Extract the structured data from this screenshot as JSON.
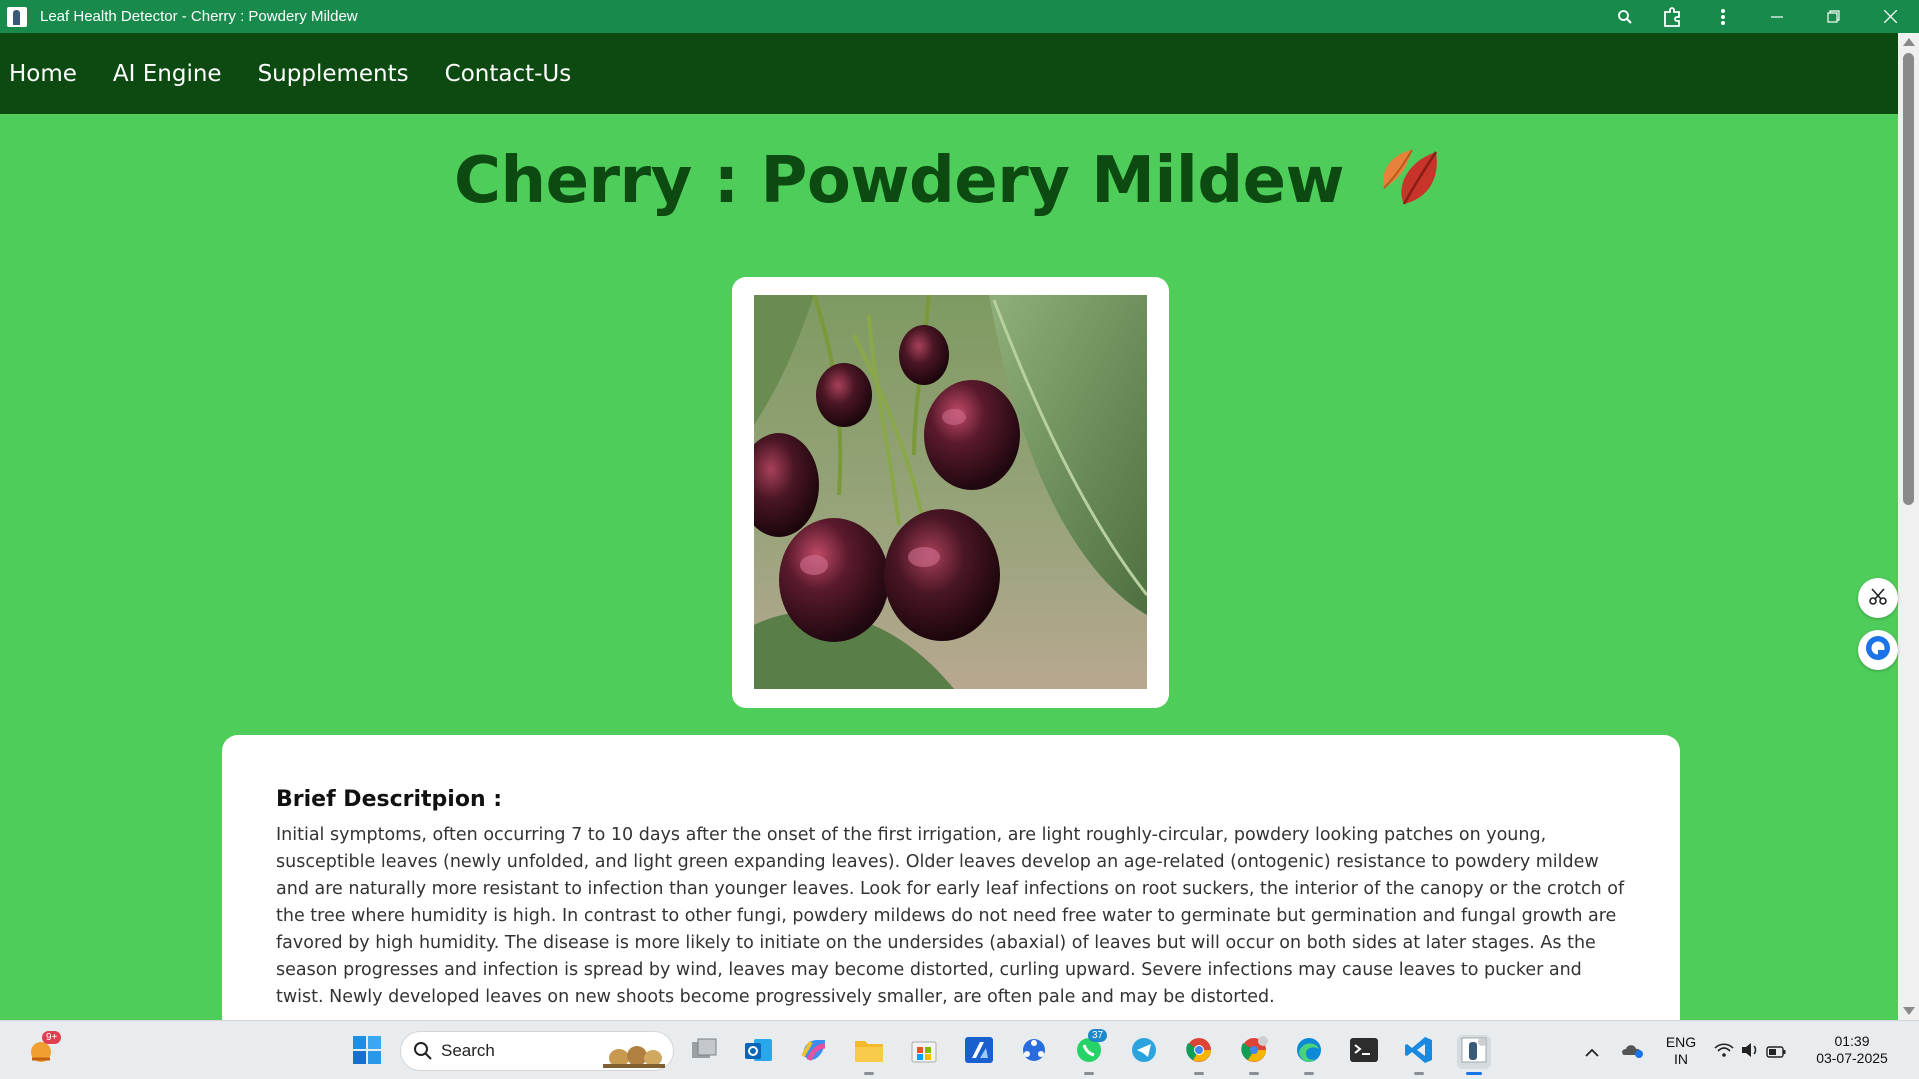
{
  "window": {
    "title": "Leaf Health Detector - Cherry : Powdery Mildew"
  },
  "nav": {
    "items": [
      "Home",
      "AI Engine",
      "Supplements",
      "Contact-Us"
    ]
  },
  "page": {
    "heading": "Cherry : Powdery Mildew",
    "description_title": "Brief Descritpion :",
    "description_text": "Initial symptoms, often occurring 7 to 10 days after the onset of the first irrigation, are light roughly-circular, powdery looking patches on young, susceptible leaves (newly unfolded, and light green expanding leaves). Older leaves develop an age-related (ontogenic) resistance to powdery mildew and are naturally more resistant to infection than younger leaves. Look for early leaf infections on root suckers, the interior of the canopy or the crotch of the tree where humidity is high. In contrast to other fungi, powdery mildews do not need free water to germinate but germination and fungal growth are favored by high humidity. The disease is more likely to initiate on the undersides (abaxial) of leaves but will occur on both sides at later stages. As the season progresses and infection is spread by wind, leaves may become distorted, curling upward. Severe infections may cause leaves to pucker and twist. Newly developed leaves on new shoots become progressively smaller, are often pale and may be distorted."
  },
  "taskbar": {
    "search_label": "Search",
    "widget_badge": "9+",
    "whatsapp_badge": "37",
    "language_line1": "ENG",
    "language_line2": "IN",
    "time": "01:39",
    "date": "03-07-2025"
  },
  "colors": {
    "page_background": "#4fcd5b",
    "navbar": "#0c4a11",
    "titlebar": "#178a4c",
    "heading": "#0c4a11"
  },
  "icons": [
    "zoom-icon",
    "extensions-icon",
    "menu-dots-icon",
    "minimize-icon",
    "maximize-icon",
    "close-icon",
    "falling-leaf-icon",
    "scissors-icon",
    "chat-icon"
  ]
}
